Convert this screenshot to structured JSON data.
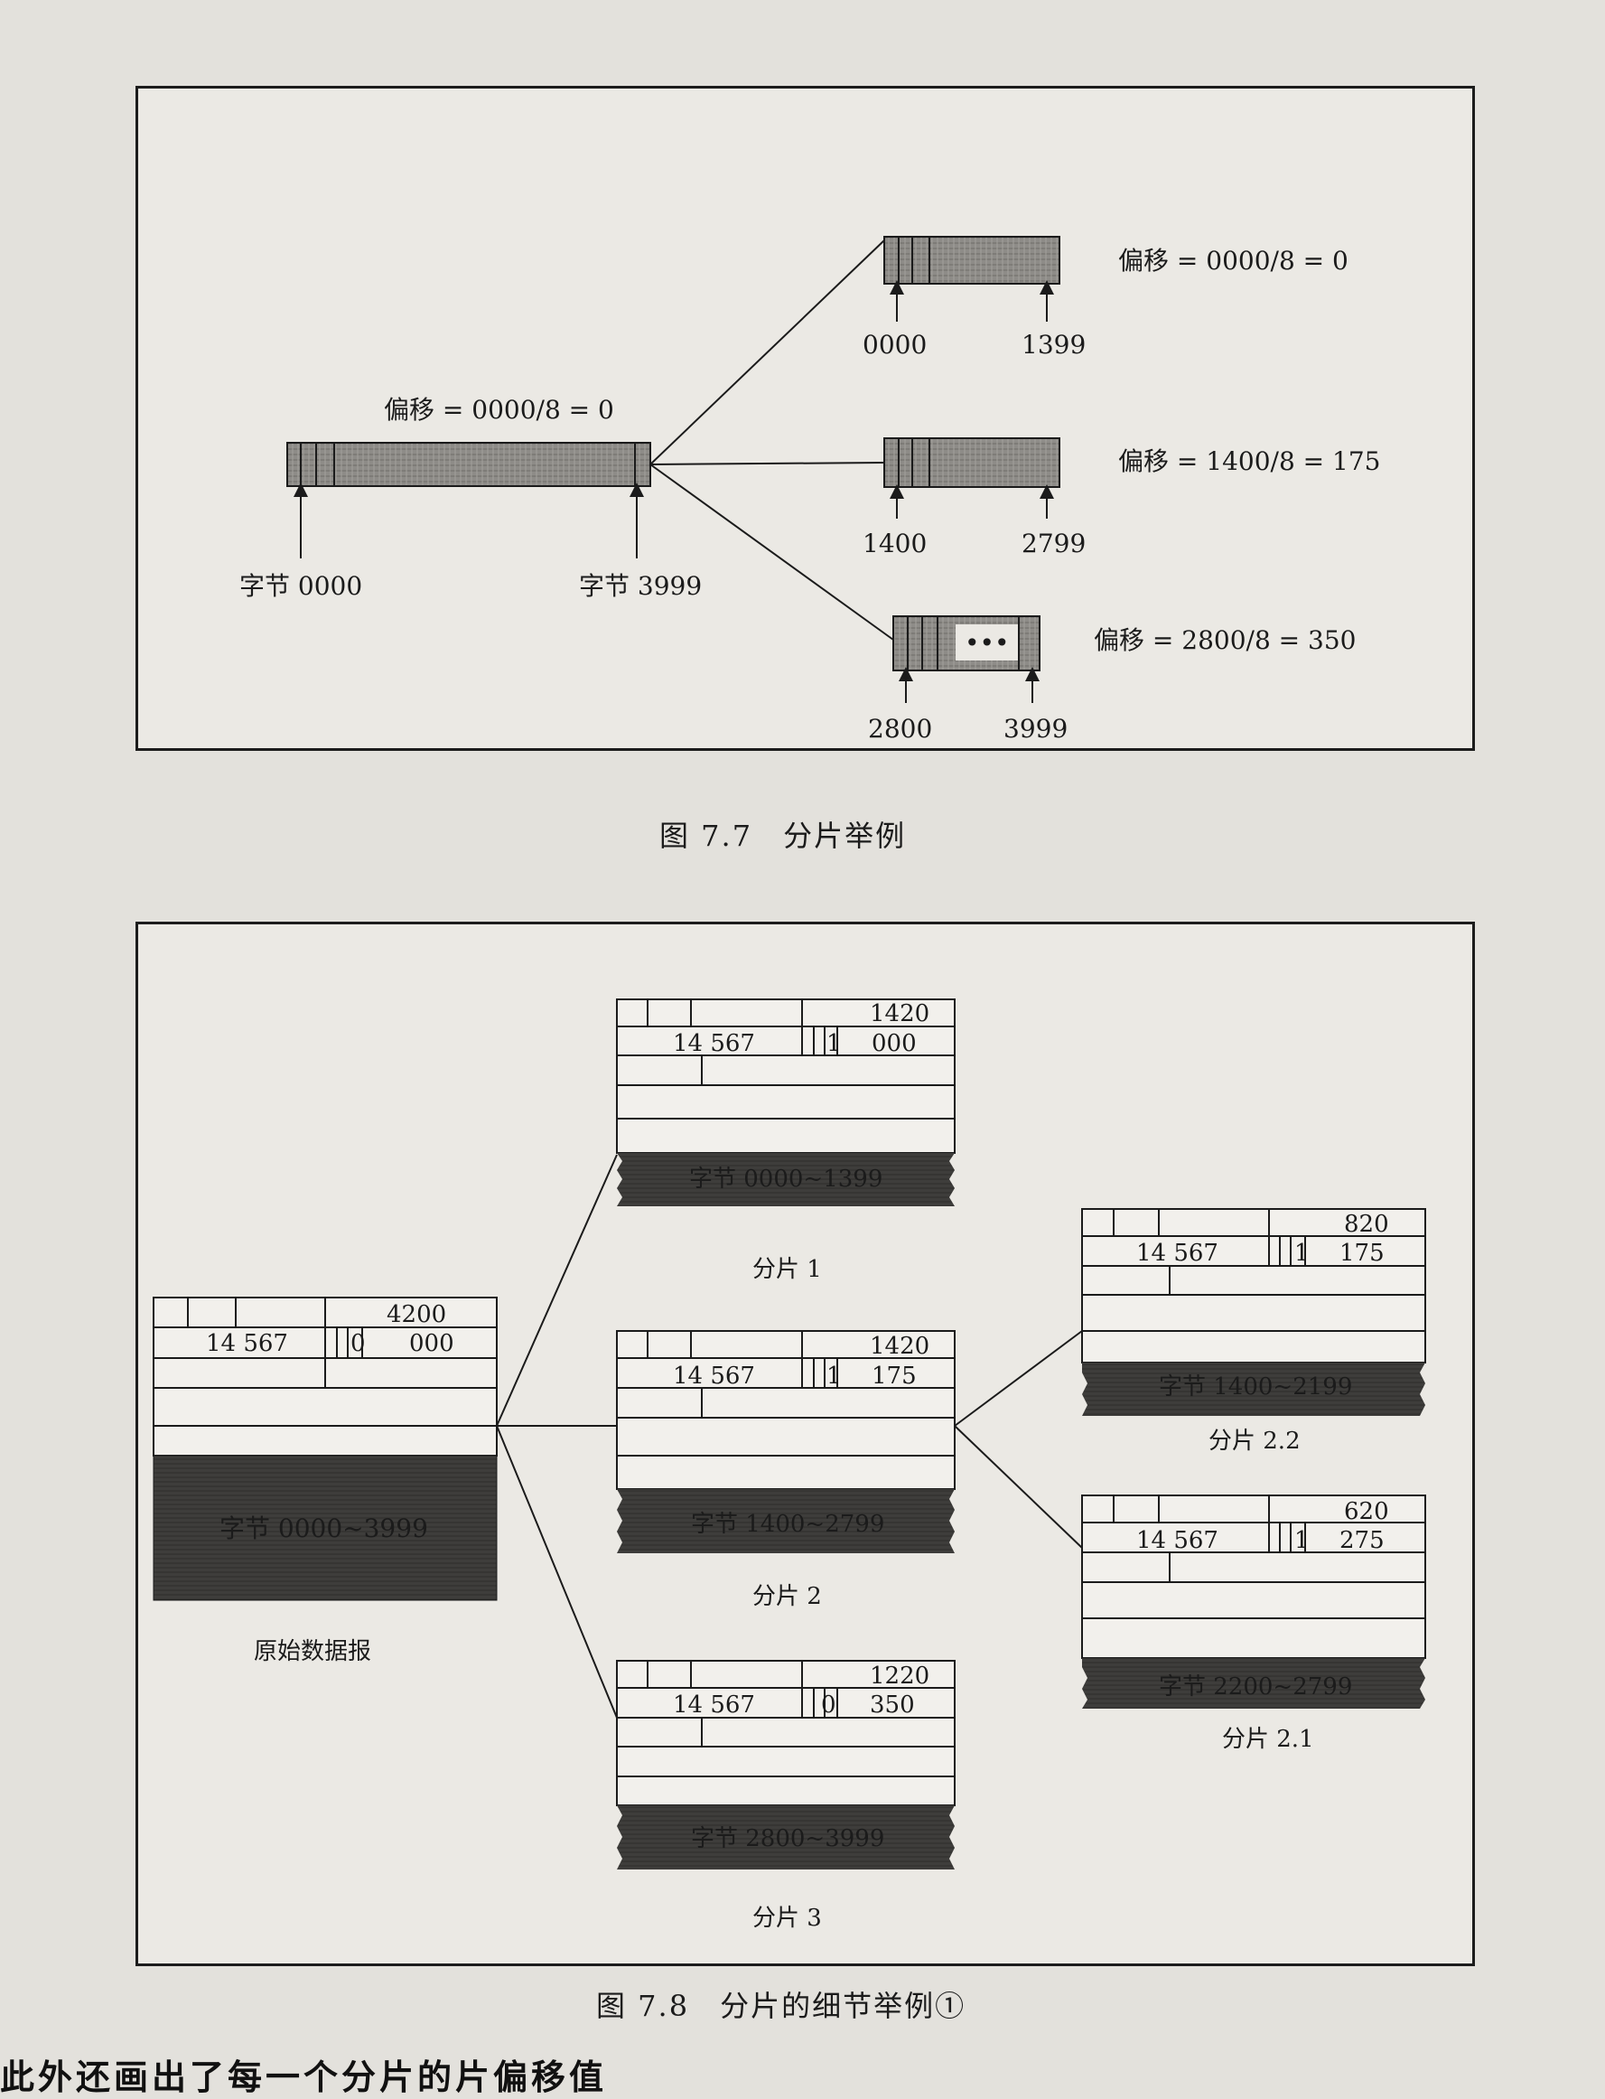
{
  "figure_7_7": {
    "caption": "图 7.7　分片举例",
    "original": {
      "offset_label": "偏移 = 0000/8 =  0",
      "start_label": "字节 0000",
      "end_label": "字节 3999"
    },
    "fragments": [
      {
        "offset_label": "偏移 = 0000/8 =  0",
        "start": "0000",
        "end": "1399"
      },
      {
        "offset_label": "偏移 = 1400/8 = 175",
        "start": "1400",
        "end": "2799"
      },
      {
        "offset_label": "偏移 = 2800/8 = 350",
        "start": "2800",
        "end": "3999",
        "dots": "•••"
      }
    ]
  },
  "figure_7_8": {
    "caption": "图 7.8　分片的细节举例①",
    "original": {
      "total_length": "4200",
      "id": "14 567",
      "mf": "0",
      "offset": "000",
      "data": "字节 0000~3999",
      "label": "原始数据报"
    },
    "frag1": {
      "total_length": "1420",
      "id": "14 567",
      "mf": "1",
      "offset": "000",
      "data": "字节 0000~1399",
      "label": "分片 1"
    },
    "frag2": {
      "total_length": "1420",
      "id": "14 567",
      "mf": "1",
      "offset": "175",
      "data": "字节 1400~2799",
      "label": "分片 2"
    },
    "frag3": {
      "total_length": "1220",
      "id": "14 567",
      "mf": "0",
      "offset": "350",
      "data": "字节 2800~3999",
      "label": "分片 3"
    },
    "frag22": {
      "total_length": "820",
      "id": "14 567",
      "mf": "1",
      "offset": "175",
      "data": "字节 1400~2199",
      "label": "分片 2.2"
    },
    "frag21": {
      "total_length": "620",
      "id": "14 567",
      "mf": "1",
      "offset": "275",
      "data": "字节 2200~2799",
      "label": "分片 2.1"
    }
  },
  "bottom_line": "此外还画出了每一个分片的片偏移值"
}
